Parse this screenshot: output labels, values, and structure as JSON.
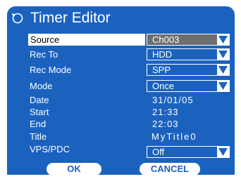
{
  "dialog": {
    "title": "Timer Editor",
    "icon": "clock-icon"
  },
  "fields": {
    "source": {
      "label": "Source",
      "value": "Ch003"
    },
    "rec_to": {
      "label": "Rec To",
      "value": "HDD"
    },
    "rec_mode": {
      "label": "Rec Mode",
      "value": "SPP"
    },
    "mode": {
      "label": "Mode",
      "value": "Once"
    },
    "date": {
      "label": "Date",
      "value": "31/01/05"
    },
    "start": {
      "label": "Start",
      "value": "21:33"
    },
    "end": {
      "label": "End",
      "value": "22:03"
    },
    "title": {
      "label": "Title",
      "value": "MyTitle0"
    },
    "vps_pdc": {
      "label": "VPS/PDC",
      "value": "Off"
    }
  },
  "buttons": {
    "ok": "OK",
    "cancel": "CANCEL"
  },
  "colors": {
    "panel_blue": "#1b62bf",
    "selected_gray": "#6e6e6e",
    "text": "#ffffff"
  }
}
